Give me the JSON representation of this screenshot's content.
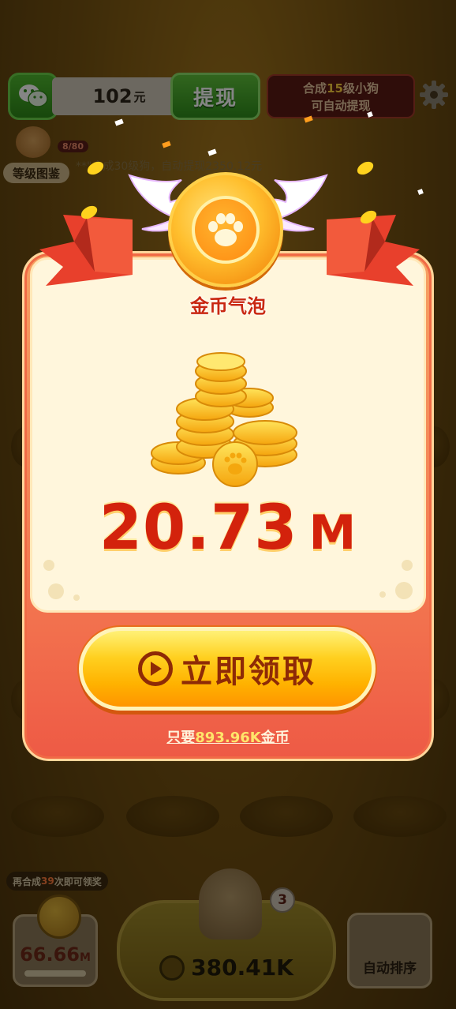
{
  "topbar": {
    "balance_value": "102",
    "balance_unit": "元",
    "withdraw_label": "提现",
    "auto_tip_prefix": "合成",
    "auto_tip_level": "15",
    "auto_tip_suffix": "级小狗",
    "auto_tip_line2": "可自动提现"
  },
  "level_book": {
    "label": "等级图鉴",
    "count": "8/80"
  },
  "ticker": "**\"合成30级狗，自动提现2350.12元",
  "popup": {
    "title": "金币气泡",
    "reward_value": "20.73",
    "reward_unit": "M",
    "claim_label": "立即领取",
    "cost_prefix": "只要",
    "cost_value": "893.96K",
    "cost_suffix": "金币"
  },
  "bottom": {
    "tip_prefix": "再合成",
    "tip_count": "39",
    "tip_suffix": "次即可领奖",
    "coin_box_value": "66.66",
    "coin_box_unit": "M",
    "buy_value": "380.41K",
    "buy_count": "3",
    "sort_label": "自动排序"
  },
  "colors": {
    "popup_top": "#f6a062",
    "popup_bottom": "#ee5a45",
    "reward_text": "#d3220c",
    "claim_button": "#ffd020",
    "title_red": "#c92812",
    "cost_highlight": "#ffe56a"
  },
  "icons": [
    "wechat-icon",
    "gear-icon",
    "paw-icon",
    "play-icon",
    "coin-icon"
  ]
}
